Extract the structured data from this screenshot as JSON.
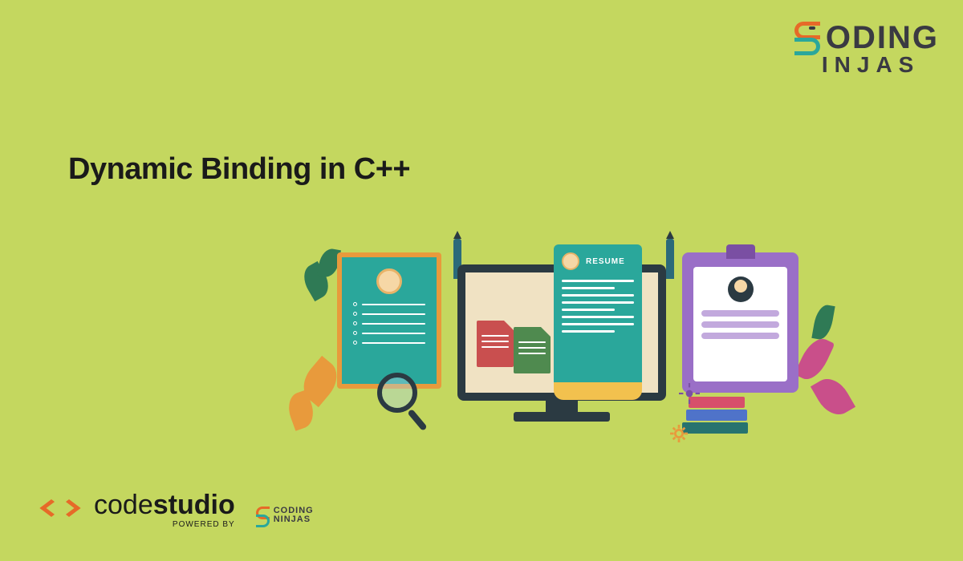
{
  "brand_top": {
    "line1": "ODING",
    "line2": "INJAS"
  },
  "title": "Dynamic Binding in C++",
  "illustration": {
    "resume_label": "RESUME"
  },
  "brand_bottom": {
    "name_light": "code",
    "name_bold": "studio",
    "powered": "POWERED BY",
    "mini_line1": "CODING",
    "mini_line2": "NINJAS"
  }
}
